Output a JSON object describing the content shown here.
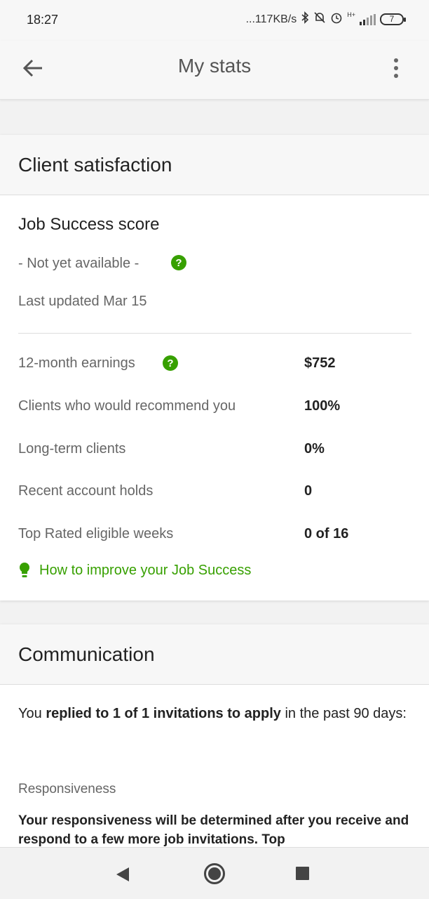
{
  "status_bar": {
    "time": "18:27",
    "network_speed": "...117KB/s",
    "network_type": "H+",
    "battery": "7"
  },
  "app_bar": {
    "title": "My stats"
  },
  "client_satisfaction": {
    "header": "Client satisfaction",
    "job_success_title": "Job Success score",
    "job_success_value": "- Not yet available -",
    "last_updated": "Last updated Mar 15",
    "stats": [
      {
        "label": "12-month earnings",
        "value": "$752"
      },
      {
        "label": "Clients who would recommend you",
        "value": "100%"
      },
      {
        "label": "Long-term clients",
        "value": "0%"
      },
      {
        "label": "Recent account holds",
        "value": "0"
      },
      {
        "label": "Top Rated eligible weeks",
        "value": "0 of 16"
      }
    ],
    "improve_link": "How to improve your Job Success",
    "accent_color": "#37a000"
  },
  "communication": {
    "header": "Communication",
    "text_prefix": "You ",
    "text_bold": "replied to 1 of 1 invitations to apply",
    "text_suffix": " in the past 90 days:",
    "responsiveness_label": "Responsiveness",
    "responsiveness_text": "Your responsiveness will be determined after you receive and respond to a few more job invitations. Top"
  }
}
